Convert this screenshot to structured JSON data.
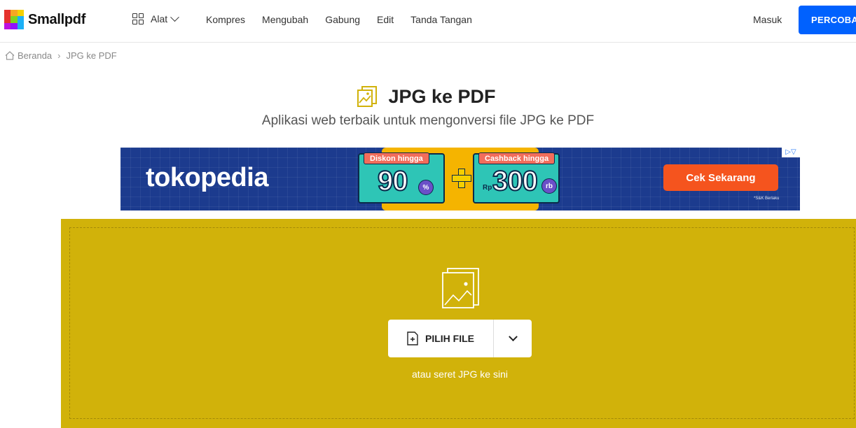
{
  "header": {
    "brand": "Smallpdf",
    "tools_label": "Alat",
    "nav": [
      "Kompres",
      "Mengubah",
      "Gabung",
      "Edit",
      "Tanda Tangan"
    ],
    "login": "Masuk",
    "try_button": "PERCOBA",
    "try_button_color": "#0061fe"
  },
  "breadcrumb": {
    "home": "Beranda",
    "separator": "›",
    "current": "JPG ke PDF"
  },
  "page": {
    "title": "JPG ke PDF",
    "subtitle": "Aplikasi web terbaik untuk mengonversi file JPG ke PDF",
    "accent_color": "#d1b20a"
  },
  "ad": {
    "brand": "tokopedia",
    "promo_left_label": "Diskon hingga",
    "promo_left_value": "90",
    "promo_left_badge": "%",
    "promo_right_label": "Cashback hingga",
    "promo_right_prefix": "Rp",
    "promo_right_value": "300",
    "promo_right_badge": "rb",
    "cta": "Cek Sekarang",
    "terms": "*S&K Berlaku",
    "choices": "▷▽"
  },
  "dropzone": {
    "pick_button": "PILIH FILE",
    "hint": "atau seret JPG ke sini"
  },
  "icons": {
    "tools": "grid-icon",
    "home": "home-icon",
    "title": "image-file-icon",
    "upload": "image-file-icon",
    "pick": "file-plus-icon",
    "dropdown": "chevron-down-icon"
  }
}
